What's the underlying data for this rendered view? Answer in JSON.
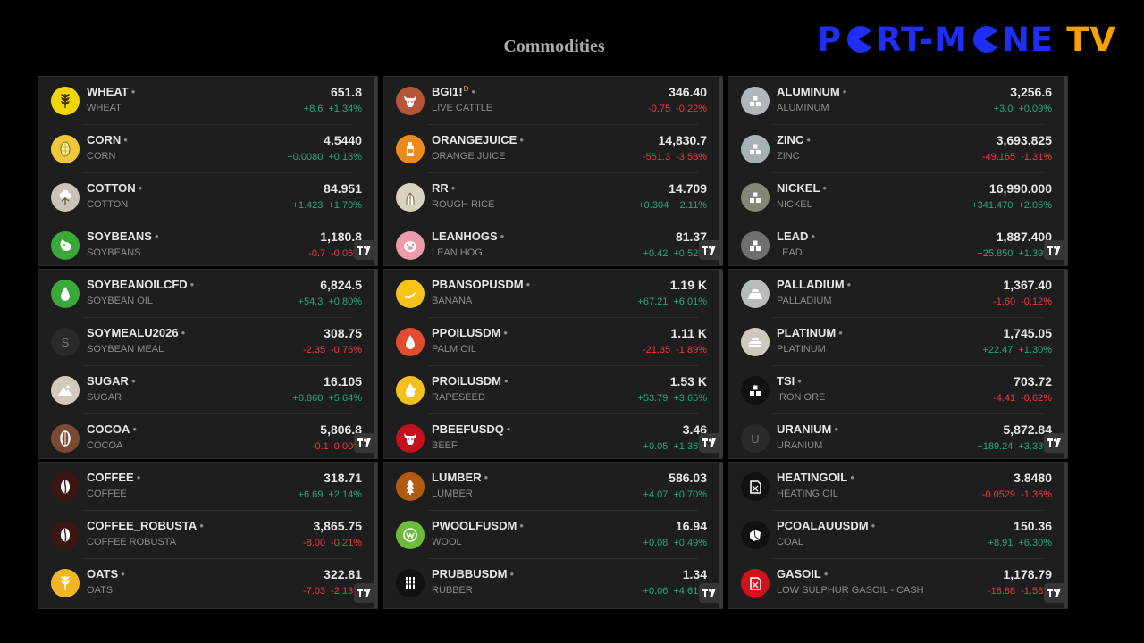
{
  "page": {
    "title": "Commodities"
  },
  "logo": {
    "part1": "P",
    "part2": "RT-M",
    "part3": "NE",
    "part4": "TV"
  },
  "colors": {
    "up": "#26a97a",
    "down": "#f23645",
    "panel": "#1e1e1e",
    "logo_blue": "#1f2ef5",
    "logo_orange": "#f5a100"
  },
  "panels": [
    {
      "rows": [
        {
          "symbol": "WHEAT",
          "desc": "WHEAT",
          "price": "651.8",
          "change": "+8.6",
          "pct": "+1.34%",
          "dir": "up",
          "icon": "wheat-icon",
          "color": "#f2d60a"
        },
        {
          "symbol": "CORN",
          "desc": "CORN",
          "price": "4.5440",
          "change": "+0.0080",
          "pct": "+0.18%",
          "dir": "up",
          "icon": "corn-icon",
          "color": "#f0c93a"
        },
        {
          "symbol": "COTTON",
          "desc": "COTTON",
          "price": "84.951",
          "change": "+1.423",
          "pct": "+1.70%",
          "dir": "up",
          "icon": "cotton-icon",
          "color": "#c9c4b6"
        },
        {
          "symbol": "SOYBEANS",
          "desc": "SOYBEANS",
          "price": "1,180.8",
          "change": "-0.7",
          "pct": "-0.06%",
          "dir": "down",
          "icon": "soybean-icon",
          "color": "#3aa83a"
        }
      ]
    },
    {
      "rows": [
        {
          "symbol": "BGI1!",
          "sup": "D",
          "desc": "LIVE CATTLE",
          "price": "346.40",
          "change": "-0.75",
          "pct": "-0.22%",
          "dir": "down",
          "icon": "cattle-icon",
          "color": "#b5563a"
        },
        {
          "symbol": "ORANGEJUICE",
          "desc": "ORANGE JUICE",
          "price": "14,830.7",
          "change": "-551.3",
          "pct": "-3.58%",
          "dir": "down",
          "icon": "juice-bottle-icon",
          "color": "#ef8a1e"
        },
        {
          "symbol": "RR",
          "desc": "ROUGH RICE",
          "price": "14.709",
          "change": "+0.304",
          "pct": "+2.11%",
          "dir": "up",
          "icon": "rice-icon",
          "color": "#d9d2c0"
        },
        {
          "symbol": "LEANHOGS",
          "desc": "LEAN HOG",
          "price": "81.37",
          "change": "+0.42",
          "pct": "+0.52%",
          "dir": "up",
          "icon": "hog-icon",
          "color": "#ee9aaa"
        }
      ]
    },
    {
      "rows": [
        {
          "symbol": "ALUMINUM",
          "desc": "ALUMINUM",
          "price": "3,256.6",
          "change": "+3.0",
          "pct": "+0.09%",
          "dir": "up",
          "icon": "metal-ingot-icon",
          "color": "#b0b6bb"
        },
        {
          "symbol": "ZINC",
          "desc": "ZINC",
          "price": "3,693.825",
          "change": "-49.165",
          "pct": "-1.31%",
          "dir": "down",
          "icon": "metal-ingot-icon",
          "color": "#a7b2b4"
        },
        {
          "symbol": "NICKEL",
          "desc": "NICKEL",
          "price": "16,990.000",
          "change": "+341.470",
          "pct": "+2.05%",
          "dir": "up",
          "icon": "metal-ingot-icon",
          "color": "#868677"
        },
        {
          "symbol": "LEAD",
          "desc": "LEAD",
          "price": "1,887.400",
          "change": "+25.850",
          "pct": "+1.39%",
          "dir": "up",
          "icon": "metal-ingot-icon",
          "color": "#6f6f6f"
        }
      ]
    },
    {
      "rows": [
        {
          "symbol": "SOYBEANOILCFD",
          "desc": "SOYBEAN OIL",
          "price": "6,824.5",
          "change": "+54.3",
          "pct": "+0.80%",
          "dir": "up",
          "icon": "oil-drop-icon",
          "color": "#3aa83a"
        },
        {
          "symbol": "SOYMEALU2026",
          "desc": "SOYBEAN MEAL",
          "price": "308.75",
          "change": "-2.35",
          "pct": "-0.76%",
          "dir": "down",
          "icon": "letter-icon",
          "letter": "S",
          "color": "#2a2a2a"
        },
        {
          "symbol": "SUGAR",
          "desc": "SUGAR",
          "price": "16.105",
          "change": "+0.860",
          "pct": "+5.64%",
          "dir": "up",
          "icon": "sugar-icon",
          "color": "#d4c9b8"
        },
        {
          "symbol": "COCOA",
          "desc": "COCOA",
          "price": "5,806.8",
          "change": "-0.1",
          "pct": "0.00%",
          "dir": "down",
          "icon": "cocoa-icon",
          "color": "#7a4a33"
        }
      ]
    },
    {
      "rows": [
        {
          "symbol": "PBANSOPUSDM",
          "desc": "BANANA",
          "price": "1.19 K",
          "change": "+67.21",
          "pct": "+6.01%",
          "dir": "up",
          "icon": "banana-icon",
          "color": "#f5c21a"
        },
        {
          "symbol": "PPOILUSDM",
          "desc": "PALM OIL",
          "price": "1.11 K",
          "change": "-21.35",
          "pct": "-1.89%",
          "dir": "down",
          "icon": "oil-drop-icon",
          "color": "#e14b2e"
        },
        {
          "symbol": "PROILUSDM",
          "desc": "RAPESEED",
          "price": "1.53 K",
          "change": "+53.79",
          "pct": "+3.65%",
          "dir": "up",
          "icon": "rapeseed-icon",
          "color": "#f3c01e"
        },
        {
          "symbol": "PBEEFUSDQ",
          "desc": "BEEF",
          "price": "3.46",
          "change": "+0.05",
          "pct": "+1.36%",
          "dir": "up",
          "icon": "beef-icon",
          "color": "#c3121d"
        }
      ]
    },
    {
      "rows": [
        {
          "symbol": "PALLADIUM",
          "desc": "PALLADIUM",
          "price": "1,367.40",
          "change": "-1.60",
          "pct": "-0.12%",
          "dir": "down",
          "icon": "metal-bars-icon",
          "color": "#b9bcbd"
        },
        {
          "symbol": "PLATINUM",
          "desc": "PLATINUM",
          "price": "1,745.05",
          "change": "+22.47",
          "pct": "+1.30%",
          "dir": "up",
          "icon": "metal-bars-icon",
          "color": "#cfc9bd"
        },
        {
          "symbol": "TSI",
          "desc": "IRON ORE",
          "price": "703.72",
          "change": "-4.41",
          "pct": "-0.62%",
          "dir": "down",
          "icon": "iron-ore-icon",
          "color": "#111111"
        },
        {
          "symbol": "URANIUM",
          "desc": "URANIUM",
          "price": "5,872.84",
          "change": "+189.24",
          "pct": "+3.33%",
          "dir": "up",
          "icon": "letter-icon",
          "letter": "U",
          "color": "#2a2a2a"
        }
      ]
    },
    {
      "rows": [
        {
          "symbol": "COFFEE",
          "desc": "COFFEE",
          "price": "318.71",
          "change": "+6.69",
          "pct": "+2.14%",
          "dir": "up",
          "icon": "coffee-bean-icon",
          "color": "#3b1712"
        },
        {
          "symbol": "COFFEE_ROBUSTA",
          "desc": "COFFEE ROBUSTA",
          "price": "3,865.75",
          "change": "-8.00",
          "pct": "-0.21%",
          "dir": "down",
          "icon": "coffee-bean-icon",
          "color": "#3b1712"
        },
        {
          "symbol": "OATS",
          "desc": "OATS",
          "price": "322.81",
          "change": "-7.03",
          "pct": "-2.13%",
          "dir": "down",
          "icon": "oats-icon",
          "color": "#f2b624"
        }
      ]
    },
    {
      "rows": [
        {
          "symbol": "LUMBER",
          "desc": "LUMBER",
          "price": "586.03",
          "change": "+4.07",
          "pct": "+0.70%",
          "dir": "up",
          "icon": "tree-icon",
          "color": "#b35a12"
        },
        {
          "symbol": "PWOOLFUSDM",
          "desc": "WOOL",
          "price": "16.94",
          "change": "+0.08",
          "pct": "+0.49%",
          "dir": "up",
          "icon": "wool-icon",
          "color": "#6dbb3a"
        },
        {
          "symbol": "PRUBBUSDM",
          "desc": "RUBBER",
          "price": "1.34",
          "change": "+0.06",
          "pct": "+4.61%",
          "dir": "up",
          "icon": "rubber-icon",
          "color": "#111111"
        }
      ]
    },
    {
      "rows": [
        {
          "symbol": "HEATINGOIL",
          "desc": "HEATING OIL",
          "price": "3.8480",
          "change": "-0.0529",
          "pct": "-1.36%",
          "dir": "down",
          "icon": "fuel-can-icon",
          "color": "#111111"
        },
        {
          "symbol": "PCOALAUUSDM",
          "desc": "COAL",
          "price": "150.36",
          "change": "+8.91",
          "pct": "+6.30%",
          "dir": "up",
          "icon": "coal-icon",
          "color": "#111111"
        },
        {
          "symbol": "GASOIL",
          "desc": "LOW SULPHUR GASOIL - CASH",
          "price": "1,178.79",
          "change": "-18.88",
          "pct": "-1.58%",
          "dir": "down",
          "icon": "fuel-can-icon",
          "color": "#d0121a"
        }
      ]
    }
  ]
}
